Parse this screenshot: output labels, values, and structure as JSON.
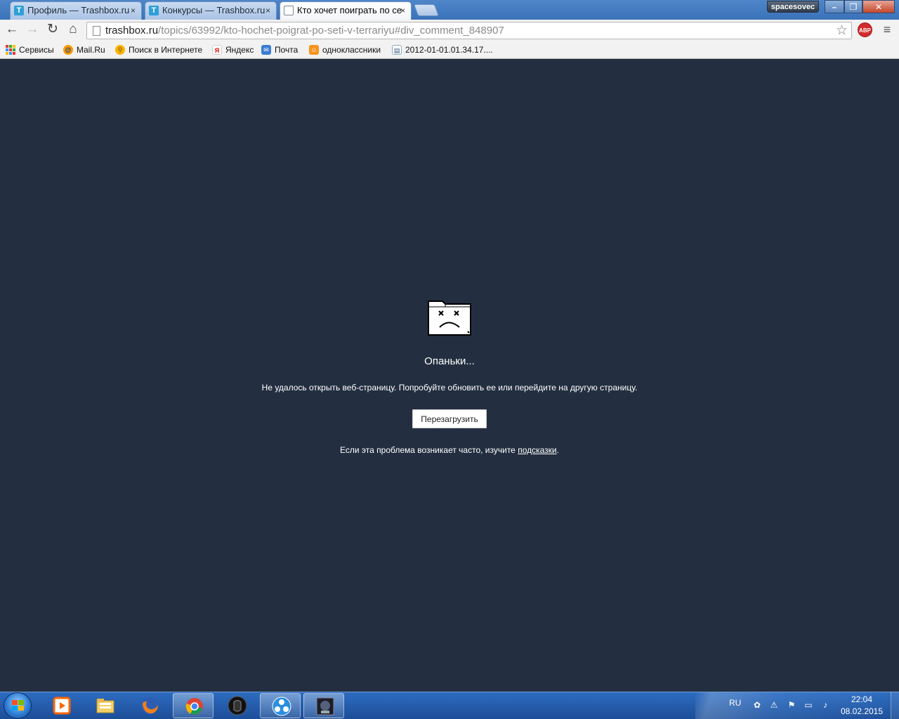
{
  "tabs": [
    {
      "title": "Профиль — Trashbox.ru",
      "favicon": "trashbox-favicon-icon"
    },
    {
      "title": "Конкурсы — Trashbox.ru",
      "favicon": "trashbox-favicon-icon"
    },
    {
      "title": "Кто хочет поиграть по се",
      "favicon": "page-icon"
    }
  ],
  "tab_close_glyph": "×",
  "favicon_letter": "T",
  "window": {
    "user": "spacesovec"
  },
  "toolbar": {
    "url_host": "trashbox.ru",
    "url_path": "/topics/63992/kto-hochet-poigrat-po-seti-v-terrariyu#div_comment_848907",
    "abp_label": "ABP"
  },
  "bookmarks": [
    {
      "label": "Сервисы",
      "icon": "apps-grid-icon"
    },
    {
      "label": "Mail.Ru",
      "icon": "mailru-icon"
    },
    {
      "label": "Поиск в Интернете",
      "icon": "search-globe-icon"
    },
    {
      "label": "Яндекс",
      "icon": "yandex-icon"
    },
    {
      "label": "Почта",
      "icon": "mail-icon"
    },
    {
      "label": "одноклассники",
      "icon": "odnoklassniki-icon"
    },
    {
      "label": "2012-01-01.01.34.17....",
      "icon": "file-icon"
    }
  ],
  "error": {
    "title": "Опаньки...",
    "message": "Не удалось открыть веб-страницу. Попробуйте обновить ее или перейдите на другую страницу.",
    "reload_label": "Перезагрузить",
    "tips_prefix": "Если эта проблема возникает часто, изучите ",
    "tips_link": "подсказки",
    "tips_suffix": "."
  },
  "taskbar": {
    "apps": [
      "media-player-icon",
      "file-explorer-icon",
      "firefox-icon",
      "chrome-icon",
      "dark-app-icon",
      "fan-app-icon",
      "game-app-icon"
    ],
    "lang": "RU",
    "time": "22:04",
    "date": "08.02.2015"
  },
  "colors": {
    "page_bg": "#232f40",
    "title_bar": "#3a72b9",
    "taskbar": "#1d4e98",
    "abp": "#d22c2c"
  }
}
